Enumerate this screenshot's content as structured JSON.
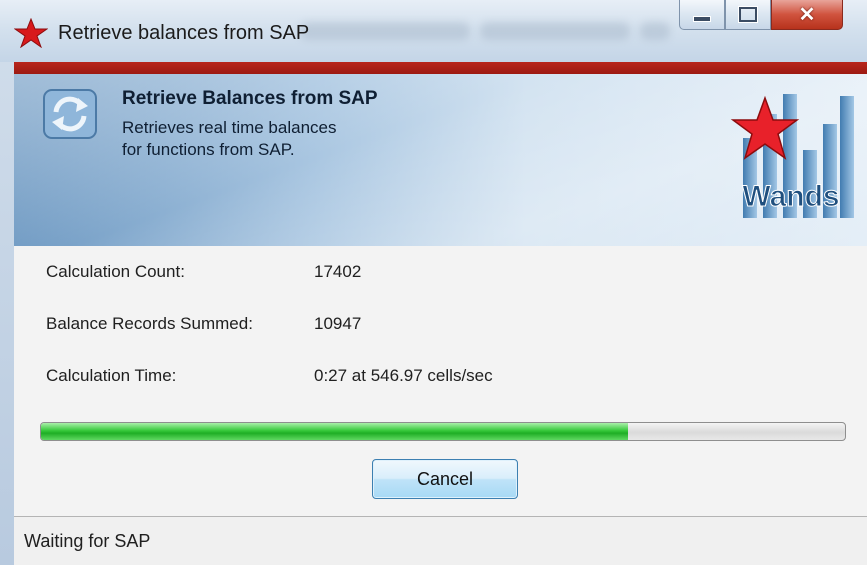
{
  "window": {
    "title": "Retrieve balances from SAP"
  },
  "header": {
    "title": "Retrieve Balances from SAP",
    "description_line1": "Retrieves real time balances",
    "description_line2": "for functions from SAP.",
    "logo_text": "Wands"
  },
  "stats": [
    {
      "label": "Calculation Count:",
      "value": "17402"
    },
    {
      "label": "Balance Records Summed:",
      "value": "10947"
    },
    {
      "label": "Calculation Time:",
      "value": "0:27 at 546.97 cells/sec"
    }
  ],
  "progress": {
    "percent": 73
  },
  "buttons": {
    "cancel_label": "Cancel"
  },
  "status": {
    "text": "Waiting for SAP"
  },
  "colors": {
    "accent_red": "#b8261c",
    "progress_green": "#36c83a",
    "header_blue": "#6f9ac3"
  },
  "icons": {
    "app": "red-star-icon",
    "header": "refresh-icon",
    "logo": "wands-logo"
  }
}
